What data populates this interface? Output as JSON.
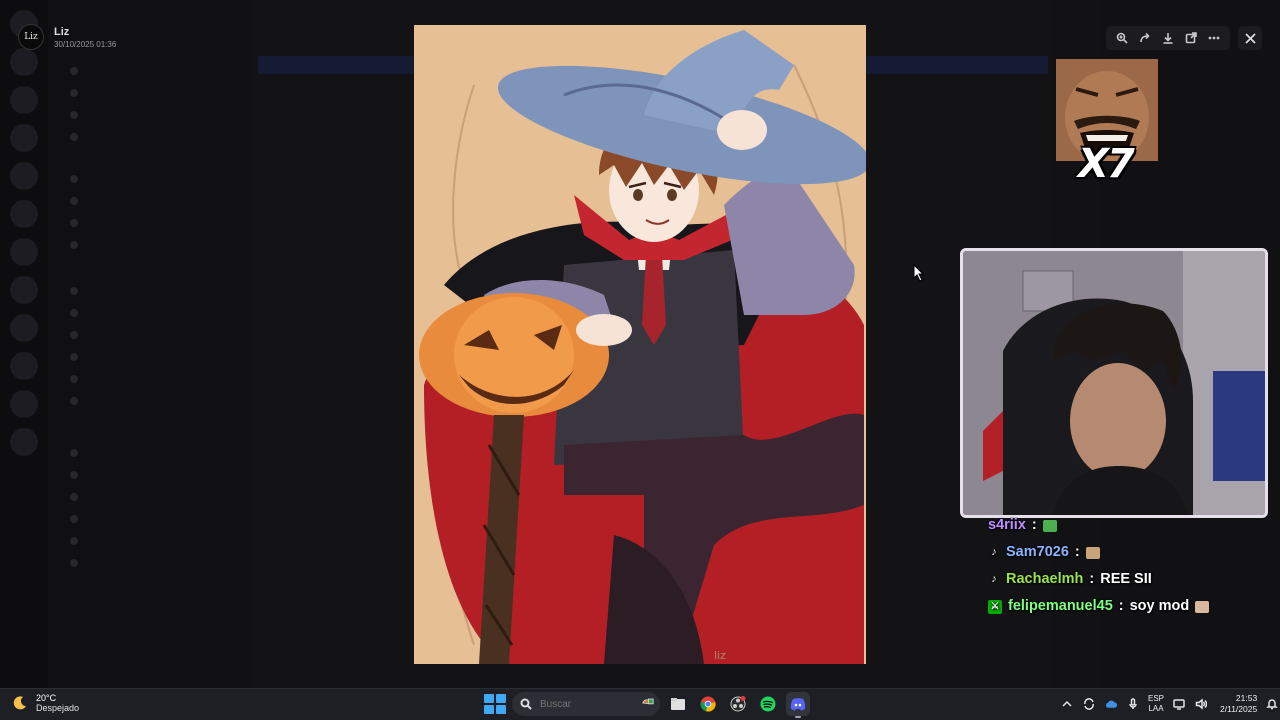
{
  "viewer": {
    "uploader": "Liz",
    "date": "30/10/2025 01:36",
    "avatar_text": "Liz"
  },
  "toolbar": {
    "icons": [
      "zoom-icon",
      "forward-icon",
      "download-icon",
      "open-external-icon",
      "more-icon"
    ],
    "close_icon": "close-icon"
  },
  "artwork": {
    "signature": "liz",
    "description_subject": "witch-hat vampire boy holding pumpkin"
  },
  "meme": {
    "multiplier": "X7"
  },
  "chat": {
    "messages": [
      {
        "user": "s4riix",
        "sep": " : ",
        "badge": "",
        "emote_color": "#4caf50"
      },
      {
        "user": "Sam7026",
        "sep": " : ",
        "badge": "♪",
        "emote_color": "#c9a47a"
      },
      {
        "user": "Rachaelmh",
        "sep": " : ",
        "badge": "♪",
        "text": "REE SII"
      },
      {
        "user": "felipemanuel45",
        "sep": " : ",
        "badge": "mod",
        "text": "soy mod",
        "emote_color": "#d9b8a0"
      }
    ]
  },
  "taskbar": {
    "weather_temp": "20°C",
    "weather_desc": "Despejado",
    "search_placeholder": "Buscar",
    "lang_top": "ESP",
    "lang_bottom": "LAA",
    "time": "21:53",
    "date": "2/11/2025"
  },
  "colors": {
    "accent_blue": "#3fa9f5",
    "chat_green": "#9be34d",
    "chat_purple": "#c08cff"
  }
}
